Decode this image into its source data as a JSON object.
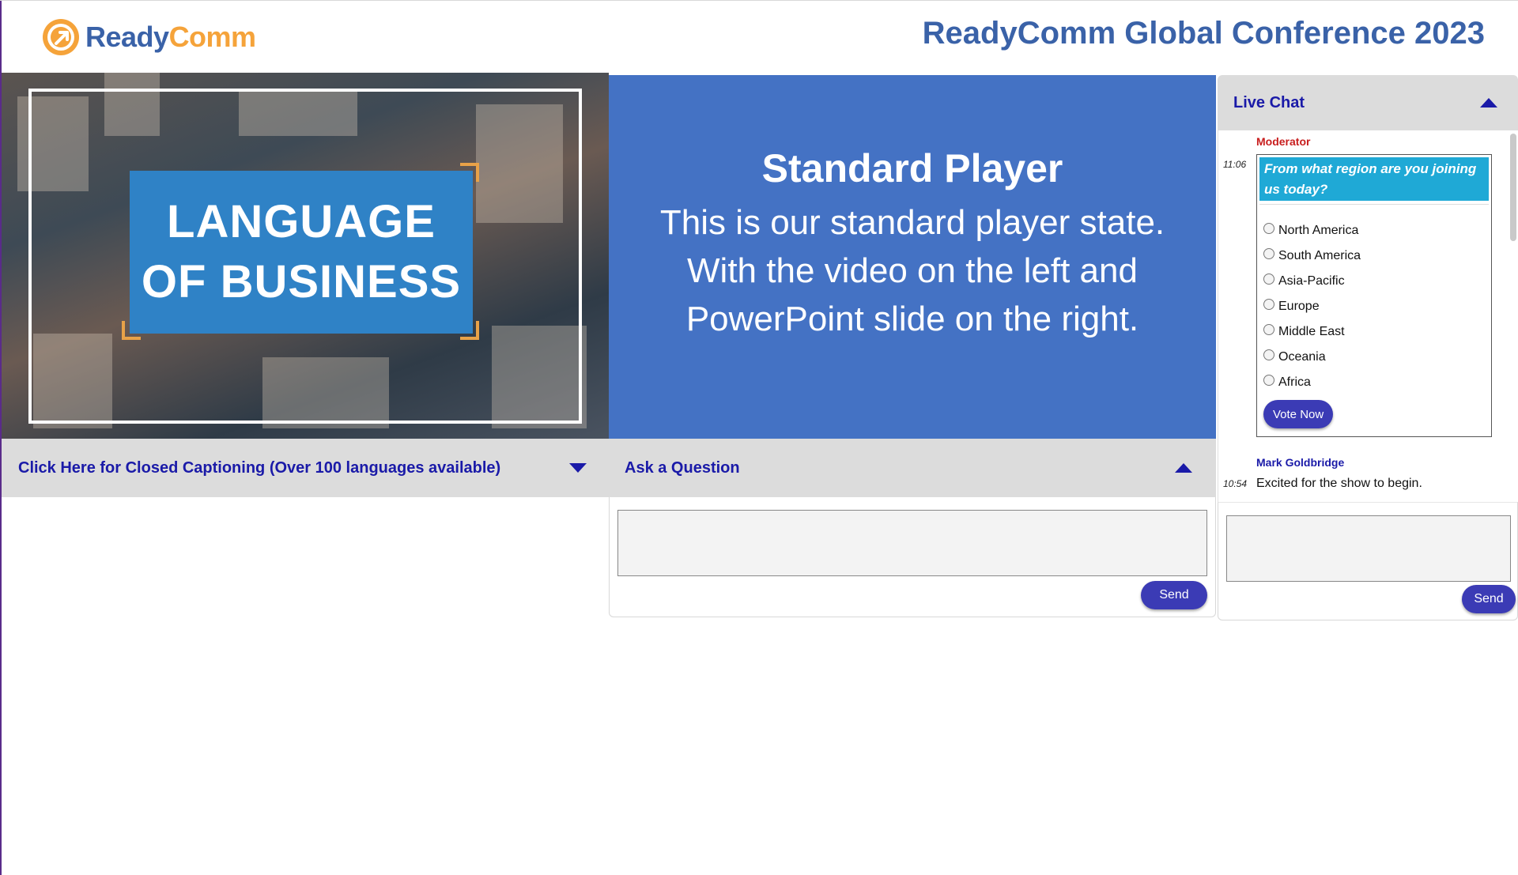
{
  "header": {
    "logo_part1": "Ready",
    "logo_part2": "Comm",
    "conference_title": "ReadyComm Global Conference 2023"
  },
  "video": {
    "title_line1": "LANGUAGE",
    "title_line2": "OF BUSINESS"
  },
  "slide": {
    "title": "Standard Player",
    "body_line1": "This is our standard player state.",
    "body_line2": "With the video on the left and",
    "body_line3": "PowerPoint slide on the right."
  },
  "captions": {
    "label": "Click Here for Closed Captioning (Over 100 languages available)"
  },
  "question": {
    "label": "Ask a Question",
    "input_value": "",
    "send_label": "Send"
  },
  "chat": {
    "title": "Live Chat",
    "moderator_label": "Moderator",
    "moderator_time": "11:06",
    "poll_question": "From what region are you joining us today?",
    "poll_options": [
      "North America",
      "South America",
      "Asia-Pacific",
      "Europe",
      "Middle East",
      "Oceania",
      "Africa"
    ],
    "vote_label": "Vote Now",
    "message_author": "Mark Goldbridge",
    "message_time": "10:54",
    "message_text": "Excited for the show to begin.",
    "input_value": "",
    "send_label": "Send"
  },
  "colors": {
    "brand_blue": "#3a62a8",
    "brand_orange": "#f5a33a",
    "slide_blue": "#4472c4",
    "link_blue": "#1a1aa8",
    "button_blue": "#3b3bb5",
    "poll_cyan": "#1fa9d6",
    "moderator_red": "#c81e1e"
  },
  "icons": {
    "captions_toggle": "triangle-down-icon",
    "question_toggle": "triangle-up-icon",
    "chat_toggle": "triangle-up-icon",
    "logo": "arrow-circle-icon"
  }
}
